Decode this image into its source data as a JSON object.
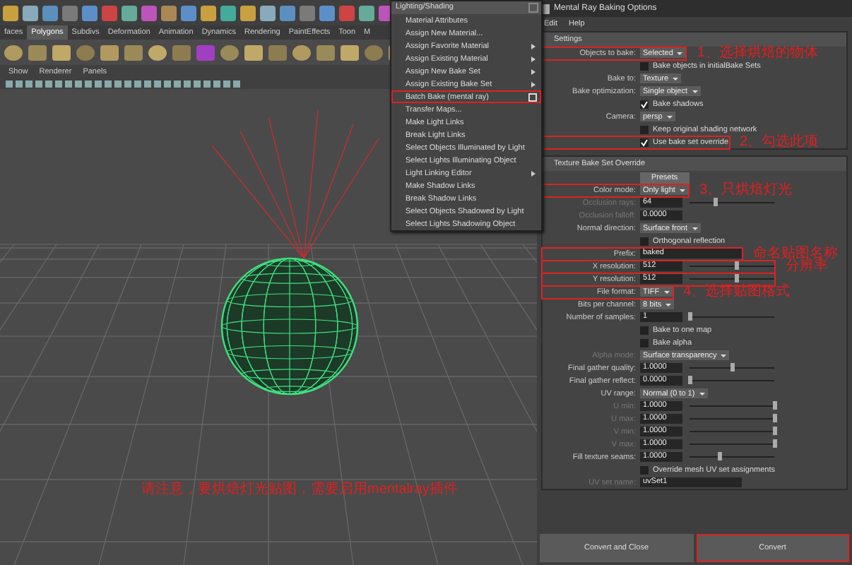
{
  "shelf_tabs": [
    {
      "label": "faces",
      "selected": false
    },
    {
      "label": "Polygons",
      "selected": true
    },
    {
      "label": "Subdivs",
      "selected": false
    },
    {
      "label": "Deformation",
      "selected": false
    },
    {
      "label": "Animation",
      "selected": false
    },
    {
      "label": "Dynamics",
      "selected": false
    },
    {
      "label": "Rendering",
      "selected": false
    },
    {
      "label": "PaintEffects",
      "selected": false
    },
    {
      "label": "Toon",
      "selected": false
    },
    {
      "label": "M",
      "selected": false
    }
  ],
  "panel_menu": [
    "Show",
    "Renderer",
    "Panels"
  ],
  "viewport": {
    "note": "请注意，要烘焙灯光贴图，需要启用mentalray插件"
  },
  "menu": {
    "title": "Lighting/Shading",
    "items": [
      {
        "label": "Material Attributes",
        "submenu": false,
        "option_box": false,
        "selected": false
      },
      {
        "label": "Assign New Material...",
        "submenu": false,
        "option_box": false,
        "selected": false
      },
      {
        "label": "Assign Favorite Material",
        "submenu": true,
        "option_box": false,
        "selected": false
      },
      {
        "label": "Assign Existing Material",
        "submenu": true,
        "option_box": false,
        "selected": false
      },
      {
        "label": "Assign New Bake Set",
        "submenu": true,
        "option_box": false,
        "selected": false
      },
      {
        "label": "Assign Existing Bake Set",
        "submenu": true,
        "option_box": false,
        "selected": false
      },
      {
        "label": "Batch Bake (mental ray)",
        "submenu": false,
        "option_box": true,
        "selected": true
      },
      {
        "label": "Transfer Maps...",
        "submenu": false,
        "option_box": false,
        "selected": false
      },
      {
        "label": "Make Light Links",
        "submenu": false,
        "option_box": false,
        "selected": false
      },
      {
        "label": "Break Light Links",
        "submenu": false,
        "option_box": false,
        "selected": false
      },
      {
        "label": "Select Objects Illuminated by Light",
        "submenu": false,
        "option_box": false,
        "selected": false
      },
      {
        "label": "Select Lights Illuminating Object",
        "submenu": false,
        "option_box": false,
        "selected": false
      },
      {
        "label": "Light Linking Editor",
        "submenu": true,
        "option_box": false,
        "selected": false
      },
      {
        "label": "Make Shadow Links",
        "submenu": false,
        "option_box": false,
        "selected": false
      },
      {
        "label": "Break Shadow Links",
        "submenu": false,
        "option_box": false,
        "selected": false
      },
      {
        "label": "Select Objects Shadowed by Light",
        "submenu": false,
        "option_box": false,
        "selected": false
      },
      {
        "label": "Select Lights Shadowing Object",
        "submenu": false,
        "option_box": false,
        "selected": false
      }
    ]
  },
  "options": {
    "title": "Mental Ray Baking Options",
    "menu": [
      "Edit",
      "Help"
    ],
    "sections": [
      {
        "title": "Settings",
        "rows": [
          {
            "kind": "dropdown",
            "label": "Objects to bake:",
            "value": "Selected",
            "disabled": false,
            "highlighted": true,
            "note": "1、选择烘焙的物体"
          },
          {
            "kind": "checkbox",
            "label": "Bake objects in initialBake Sets",
            "checked": false,
            "disabled": false,
            "highlighted": false
          },
          {
            "kind": "dropdown",
            "label": "Bake to:",
            "value": "Texture",
            "disabled": false,
            "highlighted": false
          },
          {
            "kind": "dropdown",
            "label": "Bake optimization:",
            "value": "Single object",
            "disabled": false,
            "highlighted": false
          },
          {
            "kind": "checkbox",
            "label": "Bake shadows",
            "checked": true,
            "disabled": false,
            "highlighted": false
          },
          {
            "kind": "dropdown",
            "label": "Camera:",
            "value": "persp",
            "disabled": false,
            "highlighted": false
          },
          {
            "kind": "checkbox",
            "label": "Keep original shading network",
            "checked": false,
            "disabled": false,
            "highlighted": false
          },
          {
            "kind": "checkbox",
            "label": "Use bake set override",
            "checked": true,
            "disabled": false,
            "highlighted": true,
            "note": "2、勾选此项"
          }
        ]
      },
      {
        "title": "Texture Bake Set Override",
        "rows": [
          {
            "kind": "button",
            "label": "Presets",
            "disabled": false,
            "highlighted": false
          },
          {
            "kind": "dropdown",
            "label": "Color mode:",
            "value": "Only light",
            "disabled": false,
            "highlighted": true,
            "note": "3、只烘焙灯光"
          },
          {
            "kind": "slider",
            "label": "Occlusion rays:",
            "value": "64",
            "level": 0.3,
            "disabled": true,
            "highlighted": false
          },
          {
            "kind": "value",
            "label": "Occlusion falloff:",
            "value": "0.0000",
            "disabled": true,
            "highlighted": false
          },
          {
            "kind": "dropdown",
            "label": "Normal direction:",
            "value": "Surface front",
            "disabled": false,
            "highlighted": false
          },
          {
            "kind": "checkbox",
            "label": "Orthogonal reflection",
            "checked": false,
            "disabled": false,
            "highlighted": false
          },
          {
            "kind": "text",
            "label": "Prefix:",
            "value": "baked",
            "disabled": false,
            "highlighted": true,
            "note": "命名贴图名称"
          },
          {
            "kind": "slider",
            "label": "X resolution:",
            "value": "512",
            "level": 0.55,
            "disabled": false,
            "highlighted": true,
            "note": "分辨率"
          },
          {
            "kind": "slider",
            "label": "Y resolution:",
            "value": "512",
            "level": 0.55,
            "disabled": false,
            "highlighted": true
          },
          {
            "kind": "dropdown",
            "label": "File format:",
            "value": "TIFF",
            "disabled": false,
            "highlighted": true,
            "note": "4、选择贴图格式"
          },
          {
            "kind": "dropdown",
            "label": "Bits per channel:",
            "value": "8 bits",
            "disabled": false,
            "highlighted": false
          },
          {
            "kind": "slider",
            "label": "Number of samples:",
            "value": "1",
            "level": 0,
            "disabled": false,
            "highlighted": false
          },
          {
            "kind": "checkbox",
            "label": "Bake to one map",
            "checked": false,
            "disabled": false,
            "highlighted": false
          },
          {
            "kind": "checkbox",
            "label": "Bake alpha",
            "checked": false,
            "disabled": false,
            "highlighted": false
          },
          {
            "kind": "dropdown",
            "label": "Alpha mode:",
            "value": "Surface transparency",
            "disabled": true,
            "highlighted": false
          },
          {
            "kind": "slider",
            "label": "Final gather quality:",
            "value": "1.0000",
            "level": 0.5,
            "disabled": false,
            "highlighted": false
          },
          {
            "kind": "slider",
            "label": "Final gather reflect:",
            "value": "0.0000",
            "level": 0,
            "disabled": false,
            "highlighted": false
          },
          {
            "kind": "dropdown",
            "label": "UV range:",
            "value": "Normal (0 to 1)",
            "disabled": false,
            "highlighted": false
          },
          {
            "kind": "slider",
            "label": "U min:",
            "value": "1.0000",
            "level": 1,
            "disabled": true,
            "highlighted": false
          },
          {
            "kind": "slider",
            "label": "U max:",
            "value": "1.0000",
            "level": 1,
            "disabled": true,
            "highlighted": false
          },
          {
            "kind": "slider",
            "label": "V min:",
            "value": "1.0000",
            "level": 1,
            "disabled": true,
            "highlighted": false
          },
          {
            "kind": "slider",
            "label": "V max:",
            "value": "1.0000",
            "level": 1,
            "disabled": true,
            "highlighted": false
          },
          {
            "kind": "slider",
            "label": "Fill texture seams:",
            "value": "1.0000",
            "level": 0.35,
            "disabled": false,
            "highlighted": false
          },
          {
            "kind": "checkbox",
            "label": "Override mesh UV set assignments",
            "checked": false,
            "disabled": false,
            "highlighted": false
          },
          {
            "kind": "text",
            "label": "UV set name:",
            "value": "uvSet1",
            "disabled": true,
            "highlighted": false
          }
        ]
      }
    ],
    "buttons": [
      {
        "label": "Convert and Close",
        "highlighted": false
      },
      {
        "label": "Convert",
        "highlighted": true
      }
    ]
  }
}
